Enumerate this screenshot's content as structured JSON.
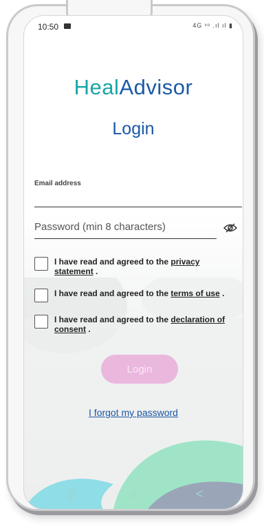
{
  "status_bar": {
    "time": "10:50",
    "icons": "4G ᵛᵒ .ıl ıl ▮"
  },
  "app": {
    "logo": "HealAdvisor",
    "logo_first": "Heal",
    "logo_second": "Advisor",
    "title": "Login"
  },
  "form": {
    "email_label": "Email address",
    "email_value": "",
    "password_placeholder": "Password (min 8 characters)",
    "password_value": ""
  },
  "consents": [
    {
      "prefix": "I have read and agreed to the ",
      "link": "privacy statement",
      "suffix": " .",
      "checked": false
    },
    {
      "prefix": "I have read and agreed to the ",
      "link": "terms of use",
      "suffix": " .",
      "checked": false
    },
    {
      "prefix": "I have read and agreed to the ",
      "link": "declaration of consent",
      "suffix": " .",
      "checked": false
    }
  ],
  "actions": {
    "login_label": "Login",
    "forgot_label": "I forgot my password"
  },
  "nav": {
    "recent": "|||",
    "home": "○",
    "back": "<"
  },
  "colors": {
    "brand_blue": "#1b57a5",
    "brand_teal": "#1aa5a6",
    "login_button": "#eab7dd"
  }
}
